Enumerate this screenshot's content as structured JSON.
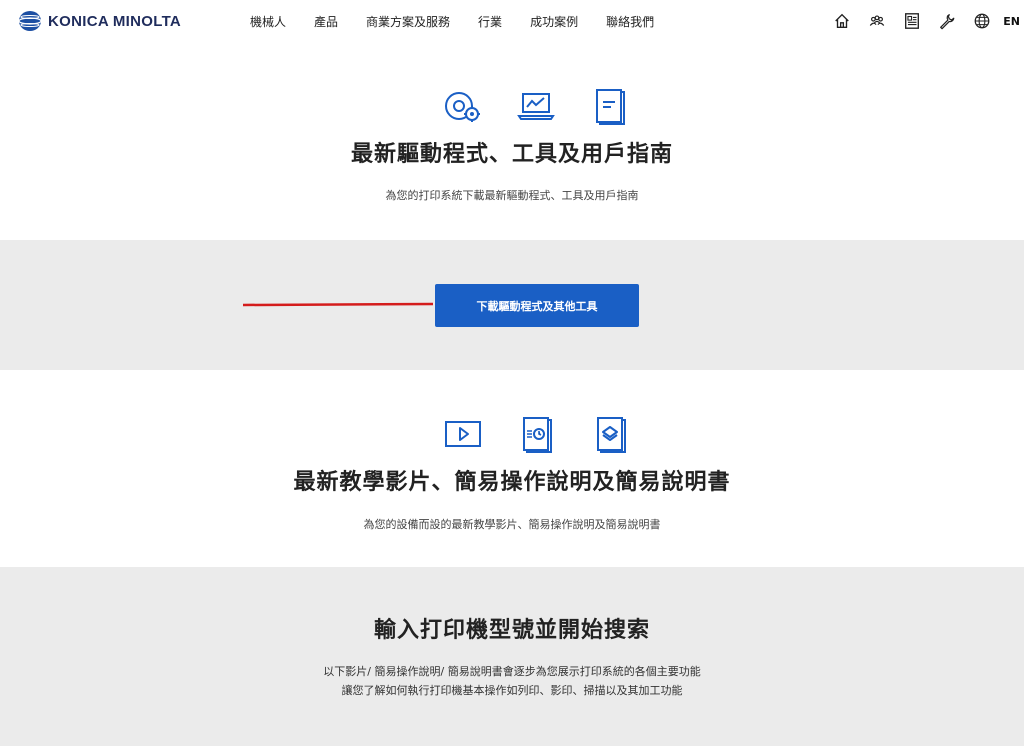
{
  "header": {
    "brand": "KONICA MINOLTA",
    "nav": [
      "機械人",
      "產品",
      "商業方案及服務",
      "行業",
      "成功案例",
      "聯絡我們"
    ],
    "language": "EN",
    "icons": [
      "home-icon",
      "people-icon",
      "news-icon",
      "wrench-icon",
      "globe-icon"
    ]
  },
  "drivers_section": {
    "icons": [
      "disc-gear-icon",
      "laptop-chart-icon",
      "manual-book-icon"
    ],
    "title": "最新驅動程式、工具及用戶指南",
    "subtitle": "為您的打印系統下載最新驅動程式、工具及用戶指南"
  },
  "download_band": {
    "button_label": "下載驅動程式及其他工具",
    "arrow_color": "#d41c1c",
    "button_color": "#1a5fc5"
  },
  "tutorials_section": {
    "icons": [
      "video-play-icon",
      "quick-guide-icon",
      "layers-book-icon"
    ],
    "title": "最新教學影片、簡易操作說明及簡易說明書",
    "subtitle": "為您的設備而設的最新教學影片、簡易操作說明及簡易說明書"
  },
  "search_section": {
    "title": "輸入打印機型號並開始搜索",
    "line1": "以下影片/ 簡易操作說明/ 簡易說明書會逐步為您展示打印系統的各個主要功能",
    "line2": "讓您了解如何執行打印機基本操作如列印、影印、掃描以及其加工功能"
  },
  "colors": {
    "icon_blue": "#1a5fc5",
    "band_grey": "#ebebeb"
  }
}
